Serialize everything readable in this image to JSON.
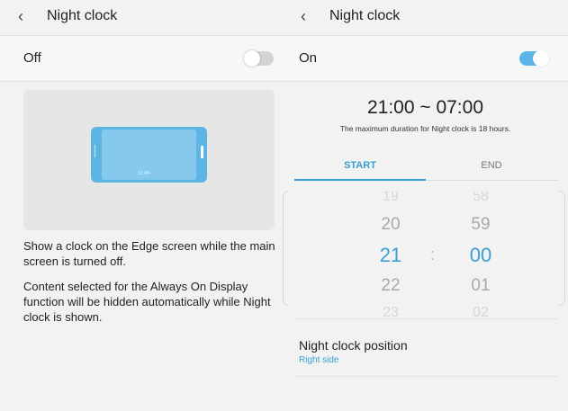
{
  "left": {
    "title": "Night clock",
    "toggle": {
      "label": "Off",
      "state": "off"
    },
    "preview": {
      "clock": "12:45•"
    },
    "description": [
      "Show a clock on the Edge screen while the main screen is turned off.",
      "Content selected for the Always On Display function will be hidden automatically while Night clock is shown."
    ]
  },
  "right": {
    "title": "Night clock",
    "toggle": {
      "label": "On",
      "state": "on"
    },
    "time_range": "21:00 ~ 07:00",
    "max_note": "The maximum duration for Night clock is 18 hours.",
    "tabs": [
      "START",
      "END"
    ],
    "active_tab": "START",
    "picker": {
      "hours": [
        "19",
        "20",
        "21",
        "22",
        "23"
      ],
      "minutes": [
        "58",
        "59",
        "00",
        "01",
        "02"
      ],
      "separator": ":"
    },
    "position": {
      "title": "Night clock position",
      "value": "Right side"
    }
  },
  "colors": {
    "accent": "#3a9ed6",
    "toggle_on": "#5ab5e6",
    "phone": "#5cb5e2"
  },
  "icons": {
    "back": "chevron-left-icon"
  }
}
